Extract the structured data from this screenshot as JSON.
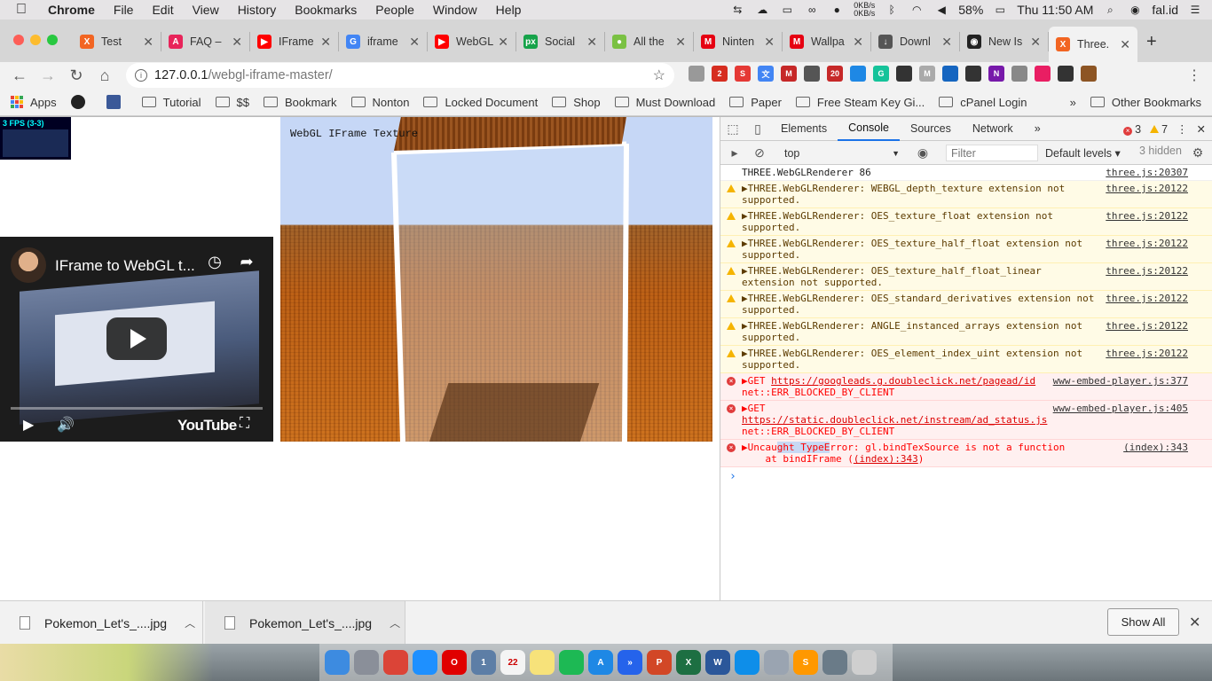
{
  "menubar": {
    "app": "Chrome",
    "items": [
      "File",
      "Edit",
      "View",
      "History",
      "Bookmarks",
      "People",
      "Window",
      "Help"
    ],
    "net_up": "0KB/s",
    "net_down": "0KB/s",
    "battery": "58%",
    "clock": "Thu 11:50 AM",
    "user": "fal.id"
  },
  "tabs": [
    {
      "title": "Test",
      "color": "#f26522",
      "glyph": "X"
    },
    {
      "title": "FAQ –",
      "color": "#e8245a",
      "glyph": "A"
    },
    {
      "title": "IFrame",
      "color": "#ff0000",
      "glyph": "▶"
    },
    {
      "title": "iframe",
      "color": "#4285f4",
      "glyph": "G"
    },
    {
      "title": "WebGL",
      "color": "#ff0000",
      "glyph": "▶"
    },
    {
      "title": "Social",
      "color": "#16a34a",
      "glyph": "px"
    },
    {
      "title": "All the",
      "color": "#7ac143",
      "glyph": "●"
    },
    {
      "title": "Ninten",
      "color": "#e60012",
      "glyph": "M"
    },
    {
      "title": "Wallpa",
      "color": "#e60012",
      "glyph": "M"
    },
    {
      "title": "Downl",
      "color": "#555555",
      "glyph": "↓"
    },
    {
      "title": "New Is",
      "color": "#222222",
      "glyph": "◉"
    },
    {
      "title": "Three.",
      "color": "#f26522",
      "glyph": "X"
    }
  ],
  "address": {
    "host": "127.0.0.1",
    "path": "/webgl-iframe-master/"
  },
  "extensions": [
    {
      "color": "#999999",
      "glyph": ""
    },
    {
      "color": "#d62d20",
      "glyph": "2"
    },
    {
      "color": "#e53935",
      "glyph": "S"
    },
    {
      "color": "#4285f4",
      "glyph": "文"
    },
    {
      "color": "#c62828",
      "glyph": "M"
    },
    {
      "color": "#555555",
      "glyph": ""
    },
    {
      "color": "#c62828",
      "glyph": "20"
    },
    {
      "color": "#1e88e5",
      "glyph": ""
    },
    {
      "color": "#15c39a",
      "glyph": "G"
    },
    {
      "color": "#333333",
      "glyph": ""
    },
    {
      "color": "#aaaaaa",
      "glyph": "M"
    },
    {
      "color": "#1565c0",
      "glyph": ""
    },
    {
      "color": "#333333",
      "glyph": ""
    },
    {
      "color": "#7719aa",
      "glyph": "N"
    },
    {
      "color": "#888888",
      "glyph": ""
    },
    {
      "color": "#e91e63",
      "glyph": ""
    },
    {
      "color": "#333333",
      "glyph": ""
    },
    {
      "color": "#8d5524",
      "glyph": ""
    }
  ],
  "bookmarks": {
    "apps": "Apps",
    "items": [
      "Tutorial",
      "$$",
      "Bookmark",
      "Nonton",
      "Locked Document",
      "Shop",
      "Must Download",
      "Paper",
      "Free Steam Key Gi...",
      "cPanel Login"
    ],
    "more": "»",
    "other": "Other Bookmarks"
  },
  "page": {
    "fps": "3 FPS (3-3)",
    "scene_label": "WebGL IFrame Texture",
    "video_title": "IFrame to WebGL t...",
    "youtube_logo": "YouTube"
  },
  "devtools": {
    "tabs": [
      "Elements",
      "Console",
      "Sources",
      "Network"
    ],
    "more": "»",
    "errors": "3",
    "warnings": "7",
    "context": "top",
    "filter_placeholder": "Filter",
    "levels": "Default levels ▾",
    "hidden": "3 hidden",
    "messages": [
      {
        "level": "info",
        "text": "THREE.WebGLRenderer 86",
        "source": "three.js:20307"
      },
      {
        "level": "warn",
        "text": "▶THREE.WebGLRenderer: WEBGL_depth_texture extension not supported.",
        "source": "three.js:20122"
      },
      {
        "level": "warn",
        "text": "▶THREE.WebGLRenderer: OES_texture_float extension not supported.",
        "source": "three.js:20122"
      },
      {
        "level": "warn",
        "text": "▶THREE.WebGLRenderer: OES_texture_half_float extension not supported.",
        "source": "three.js:20122"
      },
      {
        "level": "warn",
        "text": "▶THREE.WebGLRenderer: OES_texture_half_float_linear extension not supported.",
        "source": "three.js:20122"
      },
      {
        "level": "warn",
        "text": "▶THREE.WebGLRenderer: OES_standard_derivatives extension not supported.",
        "source": "three.js:20122"
      },
      {
        "level": "warn",
        "text": "▶THREE.WebGLRenderer: ANGLE_instanced_arrays extension not supported.",
        "source": "three.js:20122"
      },
      {
        "level": "warn",
        "text": "▶THREE.WebGLRenderer: OES_element_index_uint extension not supported.",
        "source": "three.js:20122"
      }
    ],
    "error1": {
      "prefix": "▶GET ",
      "url": "https://googleads.g.doubleclick.net/pagead/id",
      "rest": "net::ERR_BLOCKED_BY_CLIENT",
      "source": "www-embed-player.js:377"
    },
    "error2": {
      "prefix": "▶GET ",
      "url": "https://static.doubleclick.net/instream/ad_status.js",
      "rest": " net::ERR_BLOCKED_BY_CLIENT",
      "source": "www-embed-player.js:405"
    },
    "error3": {
      "pre": "▶Uncau",
      "hl": "ght TypeE",
      "post": "rror: gl.bindTexSource is not a function",
      "line2a": "    at bindIFrame (",
      "line2link": "(index):343",
      "line2b": ")",
      "source": "(index):343"
    }
  },
  "downloads": {
    "items": [
      "Pokemon_Let's_....jpg",
      "Pokemon_Let's_....jpg"
    ],
    "show_all": "Show All"
  },
  "dock": [
    {
      "color": "#3d8be0",
      "glyph": ""
    },
    {
      "color": "#8a8f99",
      "glyph": ""
    },
    {
      "color": "#db4437",
      "glyph": ""
    },
    {
      "color": "#1e90ff",
      "glyph": ""
    },
    {
      "color": "#e00000",
      "glyph": "O"
    },
    {
      "color": "#5d7ea6",
      "glyph": "1"
    },
    {
      "color": "#f4f4f4",
      "glyph": "22"
    },
    {
      "color": "#f7e27a",
      "glyph": ""
    },
    {
      "color": "#1db954",
      "glyph": ""
    },
    {
      "color": "#1e88e5",
      "glyph": "A"
    },
    {
      "color": "#2563eb",
      "glyph": "»"
    },
    {
      "color": "#d24726",
      "glyph": "P"
    },
    {
      "color": "#1d6f42",
      "glyph": "X"
    },
    {
      "color": "#2b579a",
      "glyph": "W"
    },
    {
      "color": "#0e8ee9",
      "glyph": ""
    },
    {
      "color": "#9aa4b1",
      "glyph": ""
    },
    {
      "color": "#ff9800",
      "glyph": "S"
    },
    {
      "color": "#6a7b88",
      "glyph": ""
    },
    {
      "color": "#cfcfcf",
      "glyph": ""
    }
  ]
}
